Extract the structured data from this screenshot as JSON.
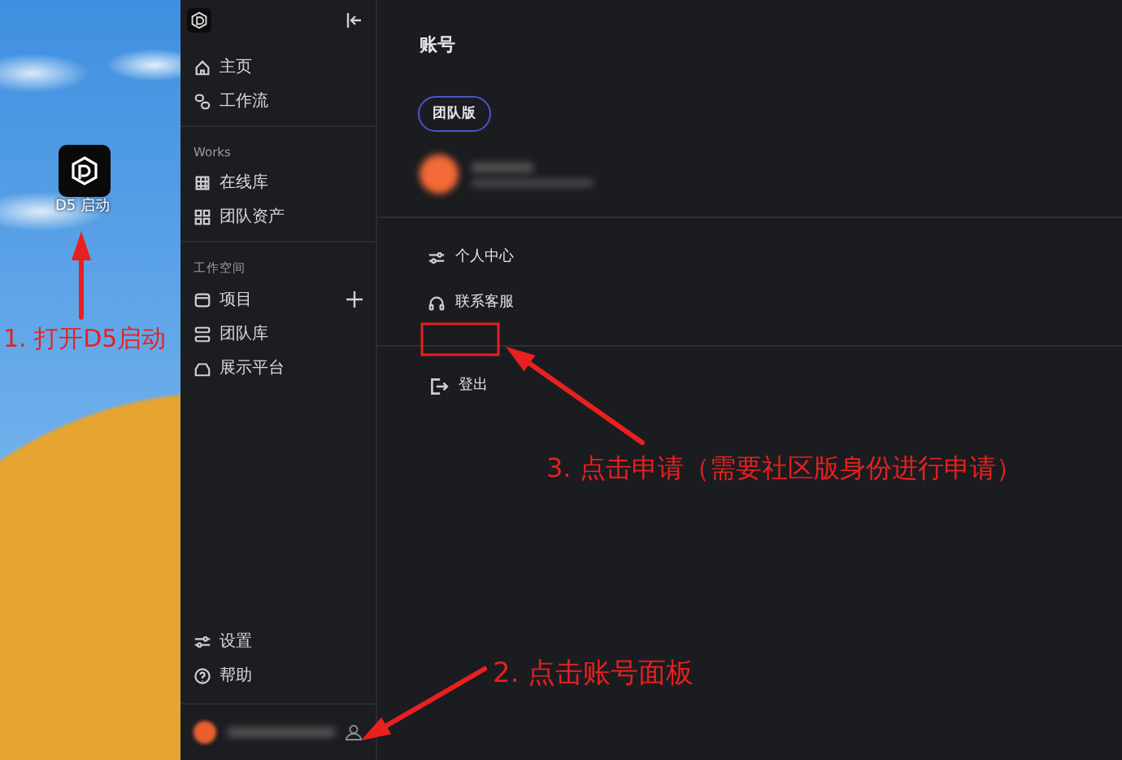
{
  "desktop": {
    "shortcut_label": "D5 启动"
  },
  "sidebar": {
    "groups": [
      {
        "items": [
          {
            "label": "主页",
            "add_button": false
          },
          {
            "label": "工作流",
            "add_button": false
          }
        ]
      },
      {
        "heading": "Works",
        "items": [
          {
            "label": "在线库",
            "add_button": false
          },
          {
            "label": "团队资产",
            "add_button": false
          }
        ]
      },
      {
        "heading": "工作空间",
        "items": [
          {
            "label": "项目",
            "add_button": true
          },
          {
            "label": "团队库",
            "add_button": false
          },
          {
            "label": "展示平台",
            "add_button": false
          }
        ]
      }
    ],
    "bottom_items": [
      {
        "label": "设置"
      },
      {
        "label": "帮助"
      }
    ]
  },
  "account": {
    "title": "账号",
    "plan_badge": "团队版",
    "menu_items": [
      {
        "label": "个人中心"
      },
      {
        "label": "联系客服"
      }
    ],
    "logout": "登出"
  },
  "annotations": [
    {
      "text": "1. 打开D5启动"
    },
    {
      "text": "3. 点击申请（需要社区版身份进行申请）"
    },
    {
      "text": "2. 点击账号面板"
    }
  ]
}
